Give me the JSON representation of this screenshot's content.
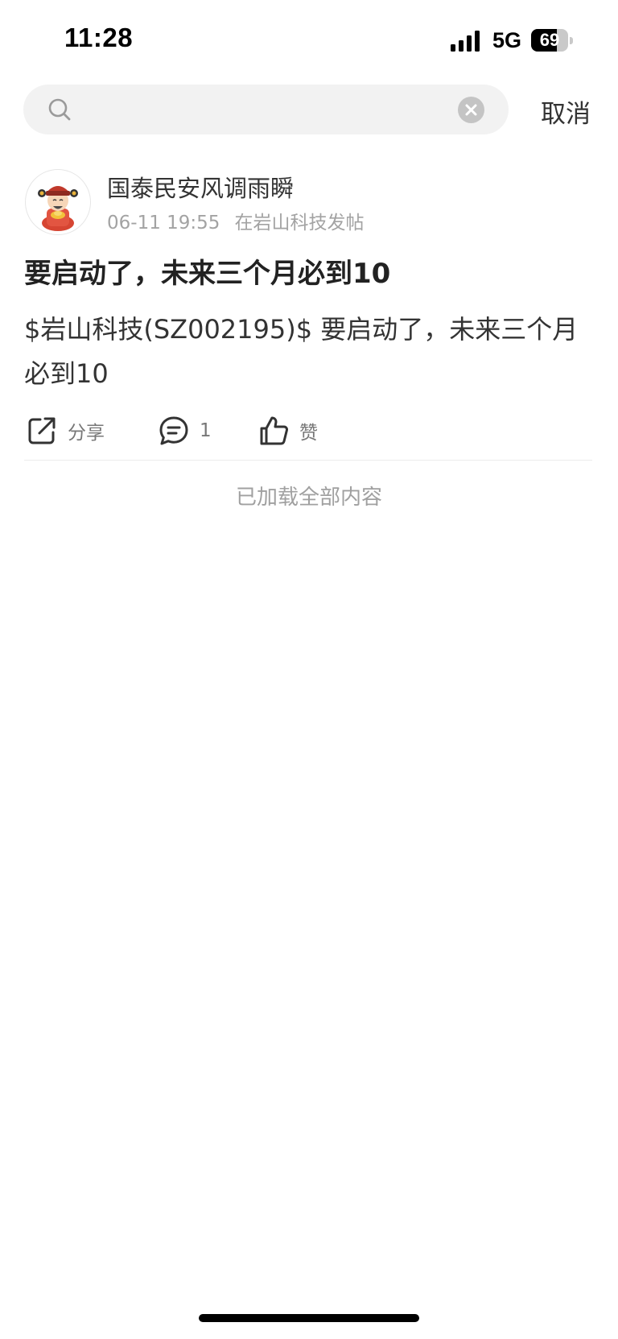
{
  "status_bar": {
    "time": "11:28",
    "network": "5G",
    "battery_level": "69",
    "battery_fraction": 0.69
  },
  "search": {
    "query": "",
    "cancel_label": "取消"
  },
  "post": {
    "author": "国泰民安风调雨瞬",
    "date": "06-11 19:55",
    "posted_in": "在岩山科技发帖",
    "title": "要启动了，未来三个月必到10",
    "body": "$岩山科技(SZ002195)$ 要启动了，未来三个月必到10",
    "actions": {
      "share_label": "分享",
      "comment_count": "1",
      "like_label": "赞"
    }
  },
  "footer_note": "已加载全部内容",
  "icons": {
    "search": "search-icon",
    "clear": "clear-icon",
    "share": "share-icon",
    "comment": "comment-icon",
    "like": "thumbs-up-icon",
    "signal": "cellular-signal-icon",
    "battery": "battery-icon"
  }
}
